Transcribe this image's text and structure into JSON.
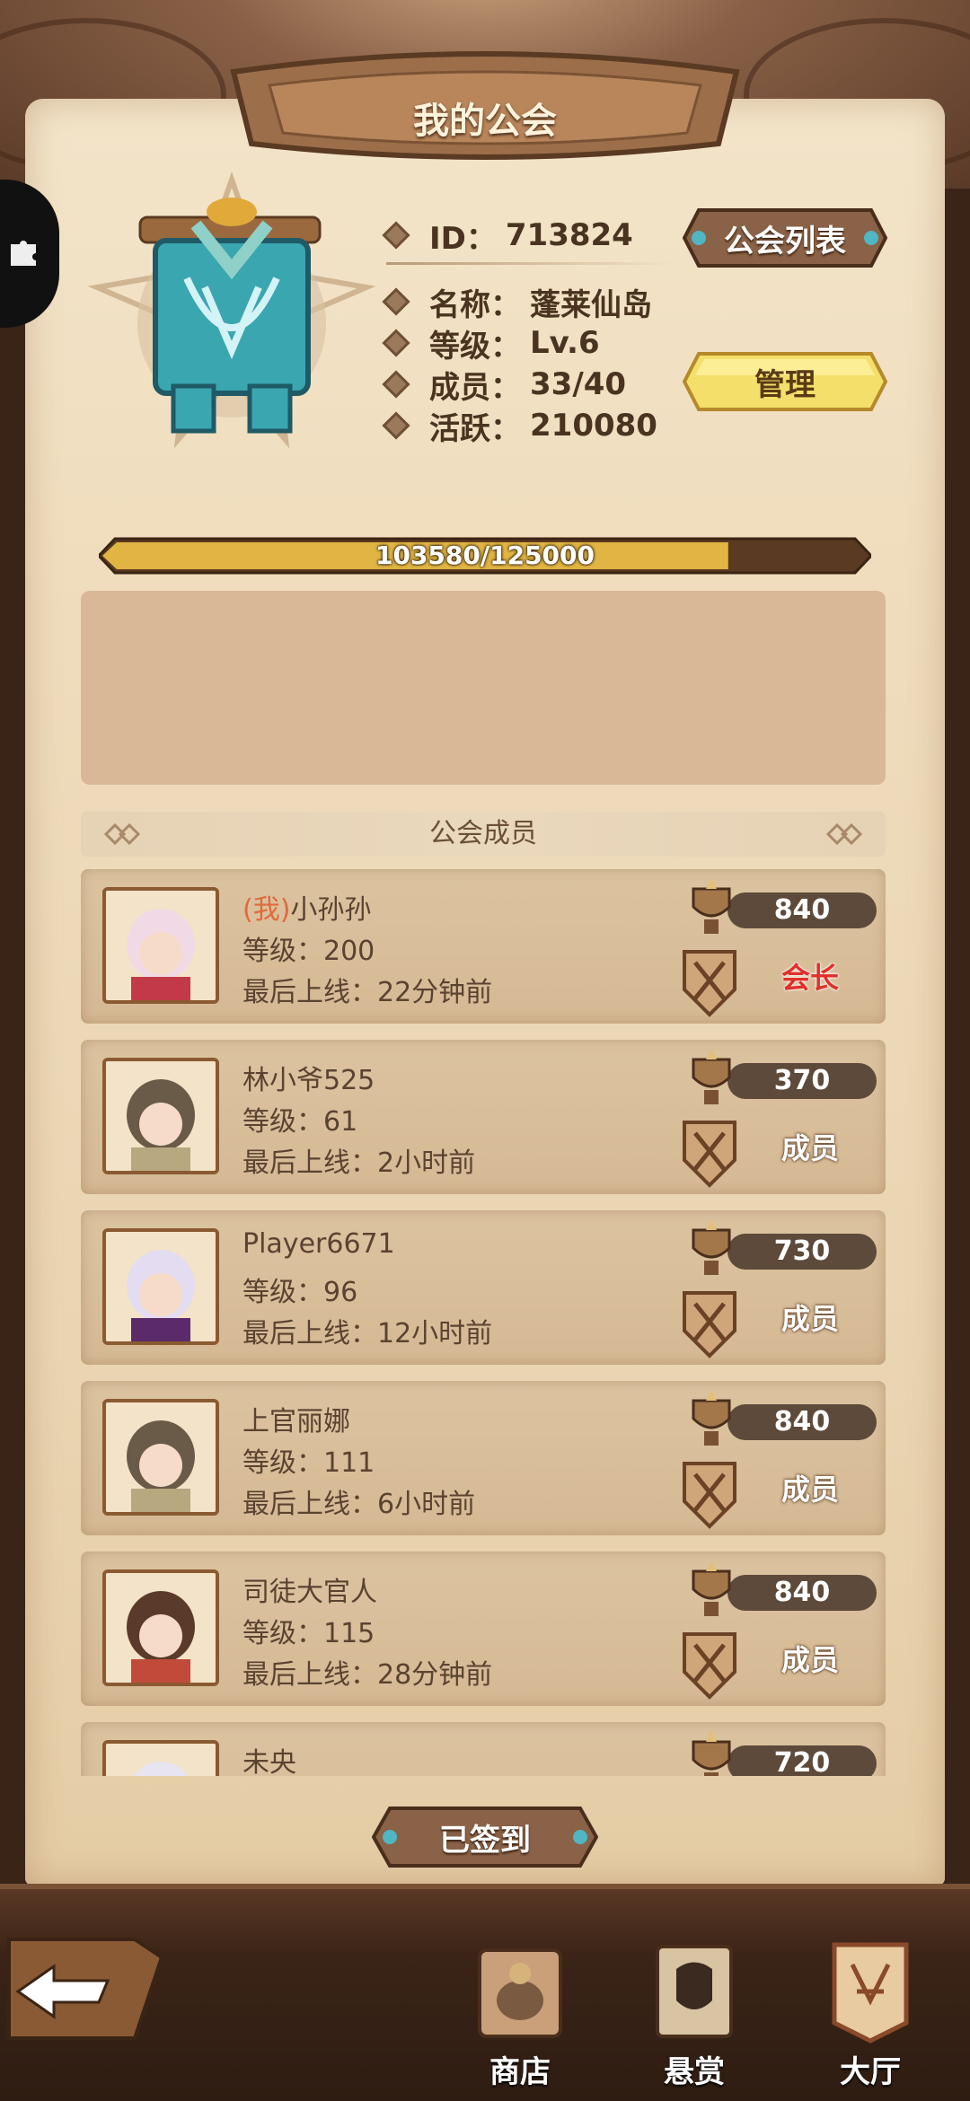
{
  "header": {
    "title": "我的公会"
  },
  "guild": {
    "id_label": "ID：",
    "id_value": "713824",
    "name_label": "名称：",
    "name_value": "蓬莱仙岛",
    "level_label": "等级：",
    "level_value": "Lv.6",
    "members_label": "成员：",
    "members_value": "33/40",
    "activity_label": "活跃：",
    "activity_value": "210080",
    "list_button": "公会列表",
    "manage_button": "管理"
  },
  "progress": {
    "text": "103580/125000",
    "current": 103580,
    "max": 125000
  },
  "members_section": {
    "title": "公会成员"
  },
  "members": [
    {
      "me_tag": "(我)",
      "name": "小孙孙",
      "level": "等级：200",
      "online": "最后上线：22分钟前",
      "score": "840",
      "role": "会长"
    },
    {
      "me_tag": "",
      "name": "林小爷525",
      "level": "等级：61",
      "online": "最后上线：2小时前",
      "score": "370",
      "role": "成员"
    },
    {
      "me_tag": "",
      "name": "Player6671",
      "level": "等级：96",
      "online": "最后上线：12小时前",
      "score": "730",
      "role": "成员"
    },
    {
      "me_tag": "",
      "name": "上官丽娜",
      "level": "等级：111",
      "online": "最后上线：6小时前",
      "score": "840",
      "role": "成员"
    },
    {
      "me_tag": "",
      "name": "司徒大官人",
      "level": "等级：115",
      "online": "最后上线：28分钟前",
      "score": "840",
      "role": "成员"
    },
    {
      "me_tag": "",
      "name": "未央",
      "level": "",
      "online": "",
      "score": "720",
      "role": ""
    }
  ],
  "signed_button": "已签到",
  "nav": {
    "shop": "商店",
    "bounty": "悬赏",
    "hall": "大厅"
  },
  "colors": {
    "gold": "#f2c94c",
    "leader_red": "#e0302a",
    "parchment": "#efdcbc"
  }
}
